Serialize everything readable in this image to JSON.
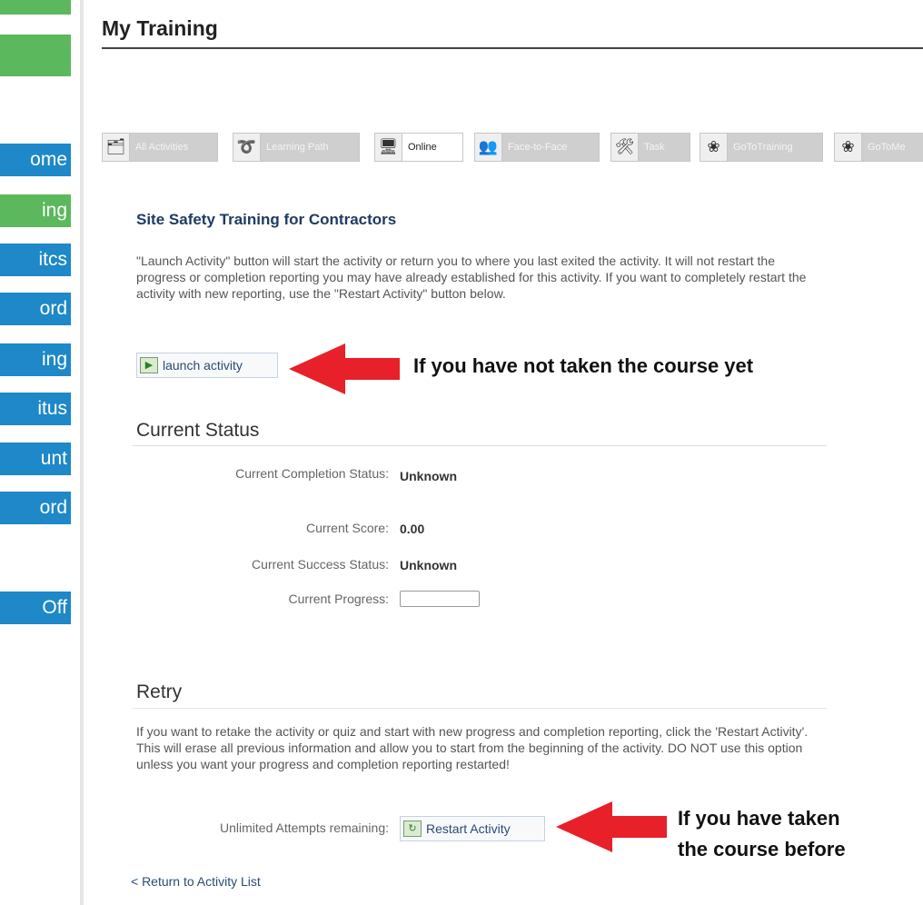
{
  "sidebar": {
    "items": [
      {
        "label": "ome",
        "active": false
      },
      {
        "label": "ing",
        "active": true
      },
      {
        "label": "itcs",
        "active": false
      },
      {
        "label": "ord",
        "active": false
      },
      {
        "label": "ing",
        "active": false
      },
      {
        "label": "itus",
        "active": false
      },
      {
        "label": "unt",
        "active": false
      },
      {
        "label": "ord",
        "active": false
      },
      {
        "label": "Off",
        "active": false
      }
    ],
    "accent": "#1e88c8",
    "active_color": "#5cb85c"
  },
  "header": {
    "title": "My Training"
  },
  "tabs": [
    {
      "label": "All Activities",
      "icon": "folder-icon",
      "selected": false
    },
    {
      "label": "Learning Path",
      "icon": "path-icon",
      "selected": false
    },
    {
      "label": "Online",
      "icon": "monitor-icon",
      "selected": true
    },
    {
      "label": "Face-to-Face",
      "icon": "people-icon",
      "selected": false
    },
    {
      "label": "Task",
      "icon": "tools-icon",
      "selected": false
    },
    {
      "label": "GoToTraining",
      "icon": "flower-icon",
      "selected": false
    },
    {
      "label": "GoToMe",
      "icon": "flower-icon",
      "selected": false
    }
  ],
  "course": {
    "title": "Site Safety Training for Contractors",
    "description": "\"Launch Activity\" button will start the activity or return you to where you last exited the activity. It will not restart the progress or completion reporting you may have already established for this activity. If you want to completely restart the activity with new reporting, use the \"Restart Activity\" button below.",
    "launch_label": "launch activity"
  },
  "annotations": {
    "launch": "If you have not taken the course yet",
    "restart_line1": "If you have taken",
    "restart_line2": "the course before",
    "arrow_color": "#e8202a"
  },
  "status": {
    "title": "Current Status",
    "completion_label": "Current Completion Status:",
    "completion_value": "Unknown",
    "score_label": "Current Score:",
    "score_value": "0.00",
    "success_label": "Current Success Status:",
    "success_value": "Unknown",
    "progress_label": "Current Progress:",
    "progress_fraction": 0
  },
  "retry": {
    "title": "Retry",
    "description": "If you want to retake the activity or quiz and start with new progress and completion reporting, click the 'Restart Activity'. This will erase all previous information and allow you to start from the beginning of the activity. DO NOT use this option unless you want your progress and completion reporting restarted!",
    "attempts_label": "Unlimited Attempts remaining:",
    "restart_label": "Restart Activity"
  },
  "footer": {
    "return_link": "< Return to Activity List"
  }
}
